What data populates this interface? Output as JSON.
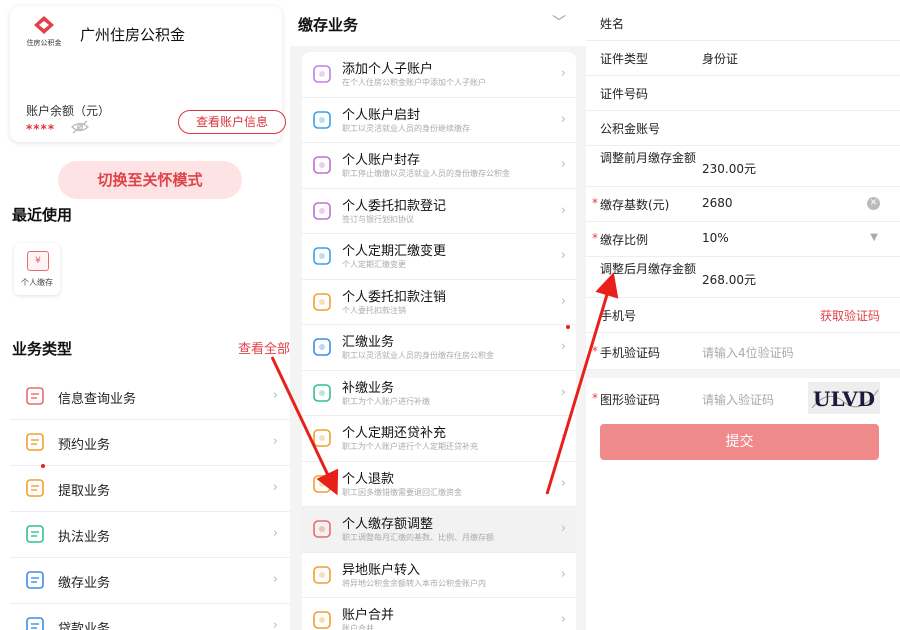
{
  "panel1": {
    "logo_text": "住房公积金",
    "fund_title": "广州住房公积金",
    "balance_label": "账户余额（元）",
    "balance_masked": "****",
    "view_account_button": "查看账户信息",
    "care_mode_button": "切换至关怀模式",
    "recent_title": "最近使用",
    "recent_items": [
      {
        "icon": "yen-card-icon",
        "label": "个人缴存"
      }
    ],
    "business_title": "业务类型",
    "view_all": "查看全部",
    "business_items": [
      {
        "label": "信息查询业务",
        "icon": "info-query-icon",
        "color": "#e86b6b"
      },
      {
        "label": "预约业务",
        "icon": "calendar-icon",
        "color": "#f0a030"
      },
      {
        "label": "提取业务",
        "icon": "wallet-icon",
        "color": "#f0a030"
      },
      {
        "label": "执法业务",
        "icon": "law-icon",
        "color": "#34c08a"
      },
      {
        "label": "缴存业务",
        "icon": "deposit-icon",
        "color": "#3a8de8"
      },
      {
        "label": "贷款业务",
        "icon": "loan-icon",
        "color": "#3a8de8"
      }
    ]
  },
  "panel2": {
    "title": "缴存业务",
    "services": [
      {
        "title": "添加个人子账户",
        "desc": "在个人住房公积金账户中添加个人子账户",
        "icon": "user-add-icon",
        "color": "#c080e0"
      },
      {
        "title": "个人账户启封",
        "desc": "职工以灵活就业人员的身份继续缴存",
        "icon": "unseal-icon",
        "color": "#3aa0e8"
      },
      {
        "title": "个人账户封存",
        "desc": "职工停止缴缴以灵活就业人员的身份缴存公积金",
        "icon": "seal-icon",
        "color": "#c070d0"
      },
      {
        "title": "个人委托扣款登记",
        "desc": "签订与银行划扣协议",
        "icon": "entrust-icon",
        "color": "#c070d0"
      },
      {
        "title": "个人定期汇缴变更",
        "desc": "个人定期汇缴变更",
        "icon": "change-icon",
        "color": "#3aa0e8"
      },
      {
        "title": "个人委托扣款注销",
        "desc": "个人委托扣款注销",
        "icon": "cancel-icon",
        "color": "#f0a030"
      },
      {
        "title": "汇缴业务",
        "desc": "职工以灵活就业人员的身份缴存住房公积金",
        "icon": "remit-icon",
        "color": "#3a8de8"
      },
      {
        "title": "补缴业务",
        "desc": "职工为个人账户进行补缴",
        "icon": "supplement-icon",
        "color": "#34c08a"
      },
      {
        "title": "个人定期还贷补充",
        "desc": "职工为个人账户进行个人定期还贷补充",
        "icon": "repay-icon",
        "color": "#f0a030"
      },
      {
        "title": "个人退款",
        "desc": "职工因多缴错缴需要退回汇缴资金",
        "icon": "refund-icon",
        "color": "#f0a030"
      },
      {
        "title": "个人缴存额调整",
        "desc": "职工调整每月汇缴的基数、比例、月缴存额",
        "icon": "adjust-icon",
        "color": "#e86b6b"
      },
      {
        "title": "异地账户转入",
        "desc": "将异地公积金余额转入本市公积金账户内",
        "icon": "transfer-in-icon",
        "color": "#f0a030"
      },
      {
        "title": "账户合并",
        "desc": "账户合并",
        "icon": "merge-icon",
        "color": "#f0a030"
      }
    ]
  },
  "panel3": {
    "fields": [
      {
        "label": "姓名",
        "value": "",
        "required": false
      },
      {
        "label": "证件类型",
        "value": "身份证",
        "required": false
      },
      {
        "label": "证件号码",
        "value": "",
        "required": false
      },
      {
        "label": "公积金账号",
        "value": "",
        "required": false
      },
      {
        "label": "调整前月缴存金额",
        "value": "230.00元",
        "required": false
      },
      {
        "label": "缴存基数(元)",
        "value": "2680",
        "required": true
      },
      {
        "label": "缴存比例",
        "value": "10%",
        "required": true
      },
      {
        "label": "调整后月缴存金额",
        "value": "268.00元",
        "required": false
      }
    ],
    "phone_label": "手机号",
    "get_code": "获取验证码",
    "sms_label": "手机验证码",
    "sms_placeholder": "请输入4位验证码",
    "captcha_label": "图形验证码",
    "captcha_placeholder": "请输入验证码",
    "captcha_text": "ULVD",
    "submit": "提交"
  },
  "colors": {
    "accent": "#e0424a",
    "submit_bg": "#f08a8a",
    "arrow": "#e8201a"
  }
}
